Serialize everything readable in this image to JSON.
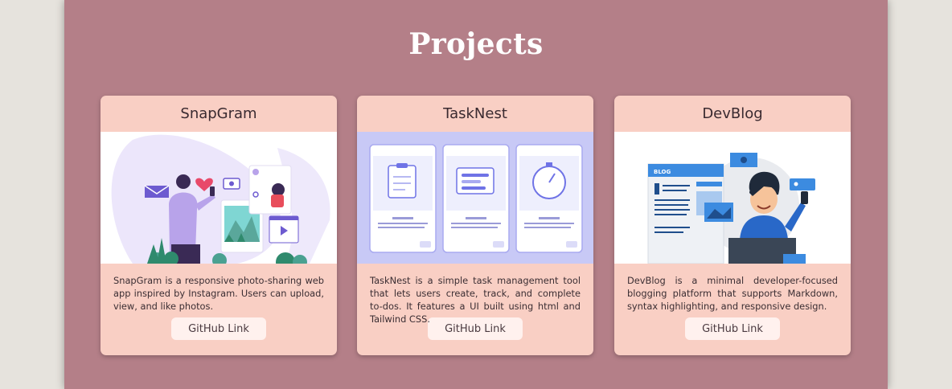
{
  "section": {
    "title": "Projects"
  },
  "projects": [
    {
      "name": "SnapGram",
      "description": "SnapGram is a responsive photo-sharing web app inspired by Instagram. Users can upload, view, and like photos.",
      "link_label": "GitHub Link",
      "image_icon": "photo-sharing-illustration"
    },
    {
      "name": "TaskNest",
      "description": "TaskNest is a simple task management tool that lets users create, track, and complete to-dos. It features a UI built using html and Tailwind CSS.",
      "link_label": "GitHub Link",
      "image_icon": "task-app-screens-illustration"
    },
    {
      "name": "DevBlog",
      "description": "DevBlog is a minimal developer-focused blogging platform that supports Markdown, syntax highlighting, and responsive design.",
      "link_label": "GitHub Link",
      "image_icon": "blogging-illustration",
      "image_text": "BLOG"
    }
  ],
  "colors": {
    "background": "#b47f88",
    "card": "#f9cfc4",
    "button": "#fff1ee",
    "outer": "#e6e3dd"
  }
}
